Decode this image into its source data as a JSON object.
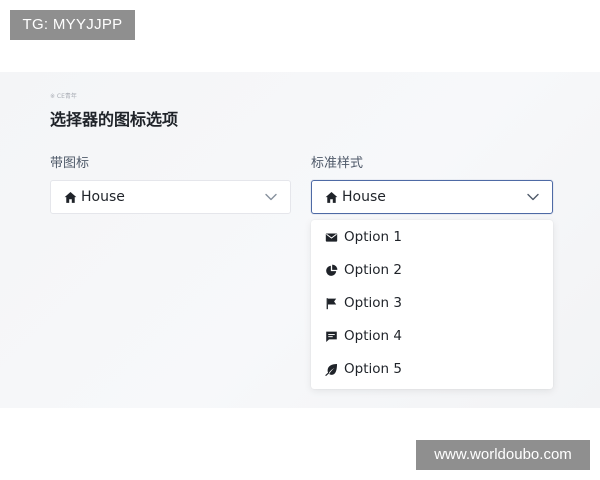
{
  "watermarks": {
    "top_left": "TG: MYYJJPP",
    "bottom_right": "www.worldoubo.com"
  },
  "header": {
    "breadcrumb": "※ CE青年",
    "title": "选择器的图标选项"
  },
  "left_field": {
    "label": "带图标",
    "value": "House",
    "icon": "home-icon"
  },
  "right_field": {
    "label": "标准样式",
    "value": "House",
    "icon": "home-icon",
    "state": "open"
  },
  "dropdown": {
    "options": [
      {
        "label": "Option 1",
        "icon": "envelope-icon"
      },
      {
        "label": "Option 2",
        "icon": "pie-chart-icon"
      },
      {
        "label": "Option 3",
        "icon": "flag-icon"
      },
      {
        "label": "Option 4",
        "icon": "comment-icon"
      },
      {
        "label": "Option 5",
        "icon": "leaf-icon"
      }
    ]
  },
  "colors": {
    "active_border": "#4e6aa5",
    "text": "#1f2329",
    "label": "#4e5969",
    "watermark_bg": "#8f8f8f"
  }
}
